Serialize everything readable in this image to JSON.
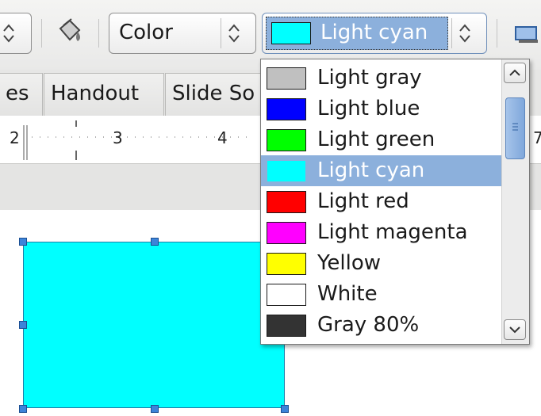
{
  "toolbar": {
    "area_style_combo": {
      "value": "Color"
    },
    "color_combo": {
      "value": "Light cyan",
      "swatch": "#00ffff"
    }
  },
  "tabs": [
    {
      "label": "es"
    },
    {
      "label": "Handout"
    },
    {
      "label": "Slide So"
    }
  ],
  "ruler": {
    "labels": [
      "2",
      "3",
      "4",
      "7"
    ]
  },
  "color_list": {
    "items": [
      {
        "label": "Light gray",
        "color": "#c0c0c0"
      },
      {
        "label": "Light blue",
        "color": "#0000ff"
      },
      {
        "label": "Light green",
        "color": "#00ff00"
      },
      {
        "label": "Light cyan",
        "color": "#00ffff",
        "selected": true
      },
      {
        "label": "Light red",
        "color": "#ff0000"
      },
      {
        "label": "Light magenta",
        "color": "#ff00ff"
      },
      {
        "label": "Yellow",
        "color": "#ffff00"
      },
      {
        "label": "White",
        "color": "#ffffff"
      },
      {
        "label": "Gray 80%",
        "color": "#333333"
      }
    ]
  },
  "shape": {
    "fill": "#00ffff"
  },
  "colors": {
    "selection": "#8cb0dc",
    "handle": "#3d84d9"
  }
}
